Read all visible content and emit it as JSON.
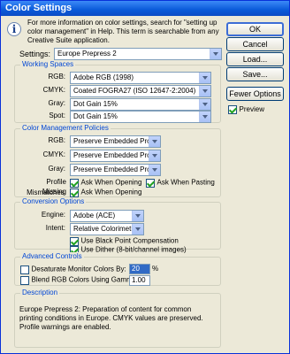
{
  "window": {
    "title": "Color Settings"
  },
  "info": {
    "text": "For more information on color settings, search for \"setting up color management\" in Help. This term is searchable from any Creative Suite application."
  },
  "buttons": {
    "ok": "OK",
    "cancel": "Cancel",
    "load": "Load...",
    "save": "Save...",
    "fewer_options": "Fewer Options"
  },
  "preview": {
    "label": "Preview",
    "checked": true
  },
  "settings": {
    "label": "Settings:",
    "value": "Europe Prepress 2"
  },
  "working_spaces": {
    "title": "Working Spaces",
    "rgb": {
      "label": "RGB:",
      "value": "Adobe RGB (1998)"
    },
    "cmyk": {
      "label": "CMYK:",
      "value": "Coated FOGRA27 (ISO 12647-2:2004)"
    },
    "gray": {
      "label": "Gray:",
      "value": "Dot Gain 15%"
    },
    "spot": {
      "label": "Spot:",
      "value": "Dot Gain 15%"
    }
  },
  "policies": {
    "title": "Color Management Policies",
    "rgb": {
      "label": "RGB:",
      "value": "Preserve Embedded Profiles"
    },
    "cmyk": {
      "label": "CMYK:",
      "value": "Preserve Embedded Profiles"
    },
    "gray": {
      "label": "Gray:",
      "value": "Preserve Embedded Profiles"
    },
    "mismatch_label": "Profile Mismatches:",
    "ask_opening": "Ask When Opening",
    "ask_pasting": "Ask When Pasting",
    "missing_label": "Missing Profiles:",
    "missing_ask_opening": "Ask When Opening"
  },
  "conversion": {
    "title": "Conversion Options",
    "engine": {
      "label": "Engine:",
      "value": "Adobe (ACE)"
    },
    "intent": {
      "label": "Intent:",
      "value": "Relative Colorimetric"
    },
    "black_point": "Use Black Point Compensation",
    "dither": "Use Dither (8-bit/channel images)"
  },
  "advanced": {
    "title": "Advanced Controls",
    "desaturate": {
      "label": "Desaturate Monitor Colors By:",
      "value": "20",
      "unit": "%"
    },
    "blend": {
      "label": "Blend RGB Colors Using Gamma:",
      "value": "1.00"
    }
  },
  "description": {
    "title": "Description",
    "text": "Europe Prepress 2:  Preparation of content for common printing conditions in Europe. CMYK values are preserved. Profile warnings are enabled."
  }
}
